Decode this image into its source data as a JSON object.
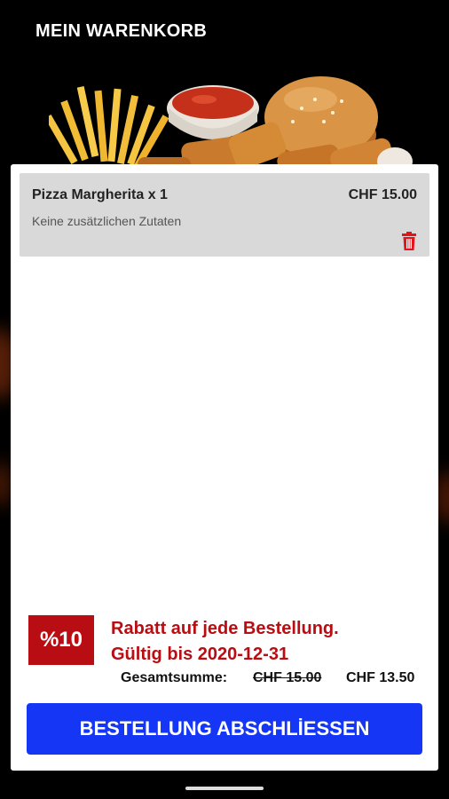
{
  "header": {
    "title": "MEIN WARENKORB"
  },
  "cart": {
    "items": [
      {
        "name": "Pizza Margherita x 1",
        "price": "CHF 15.00",
        "extras": "Keine zusätzlichen Zutaten",
        "delete_icon": "trash-icon"
      }
    ]
  },
  "discount": {
    "badge": "%10",
    "line1": "Rabatt auf jede Bestellung.",
    "line2": "Gültig bis 2020-12-31"
  },
  "totals": {
    "label": "Gesamtsumme:",
    "original": "CHF 15.00",
    "final": "CHF 13.50"
  },
  "checkout": {
    "label": "BESTELLUNG ABSCHLİESSEN"
  },
  "colors": {
    "accent": "#1537f5",
    "discount_red": "#b80d12",
    "background": "#000000",
    "item_bg": "#d9d9d9"
  }
}
